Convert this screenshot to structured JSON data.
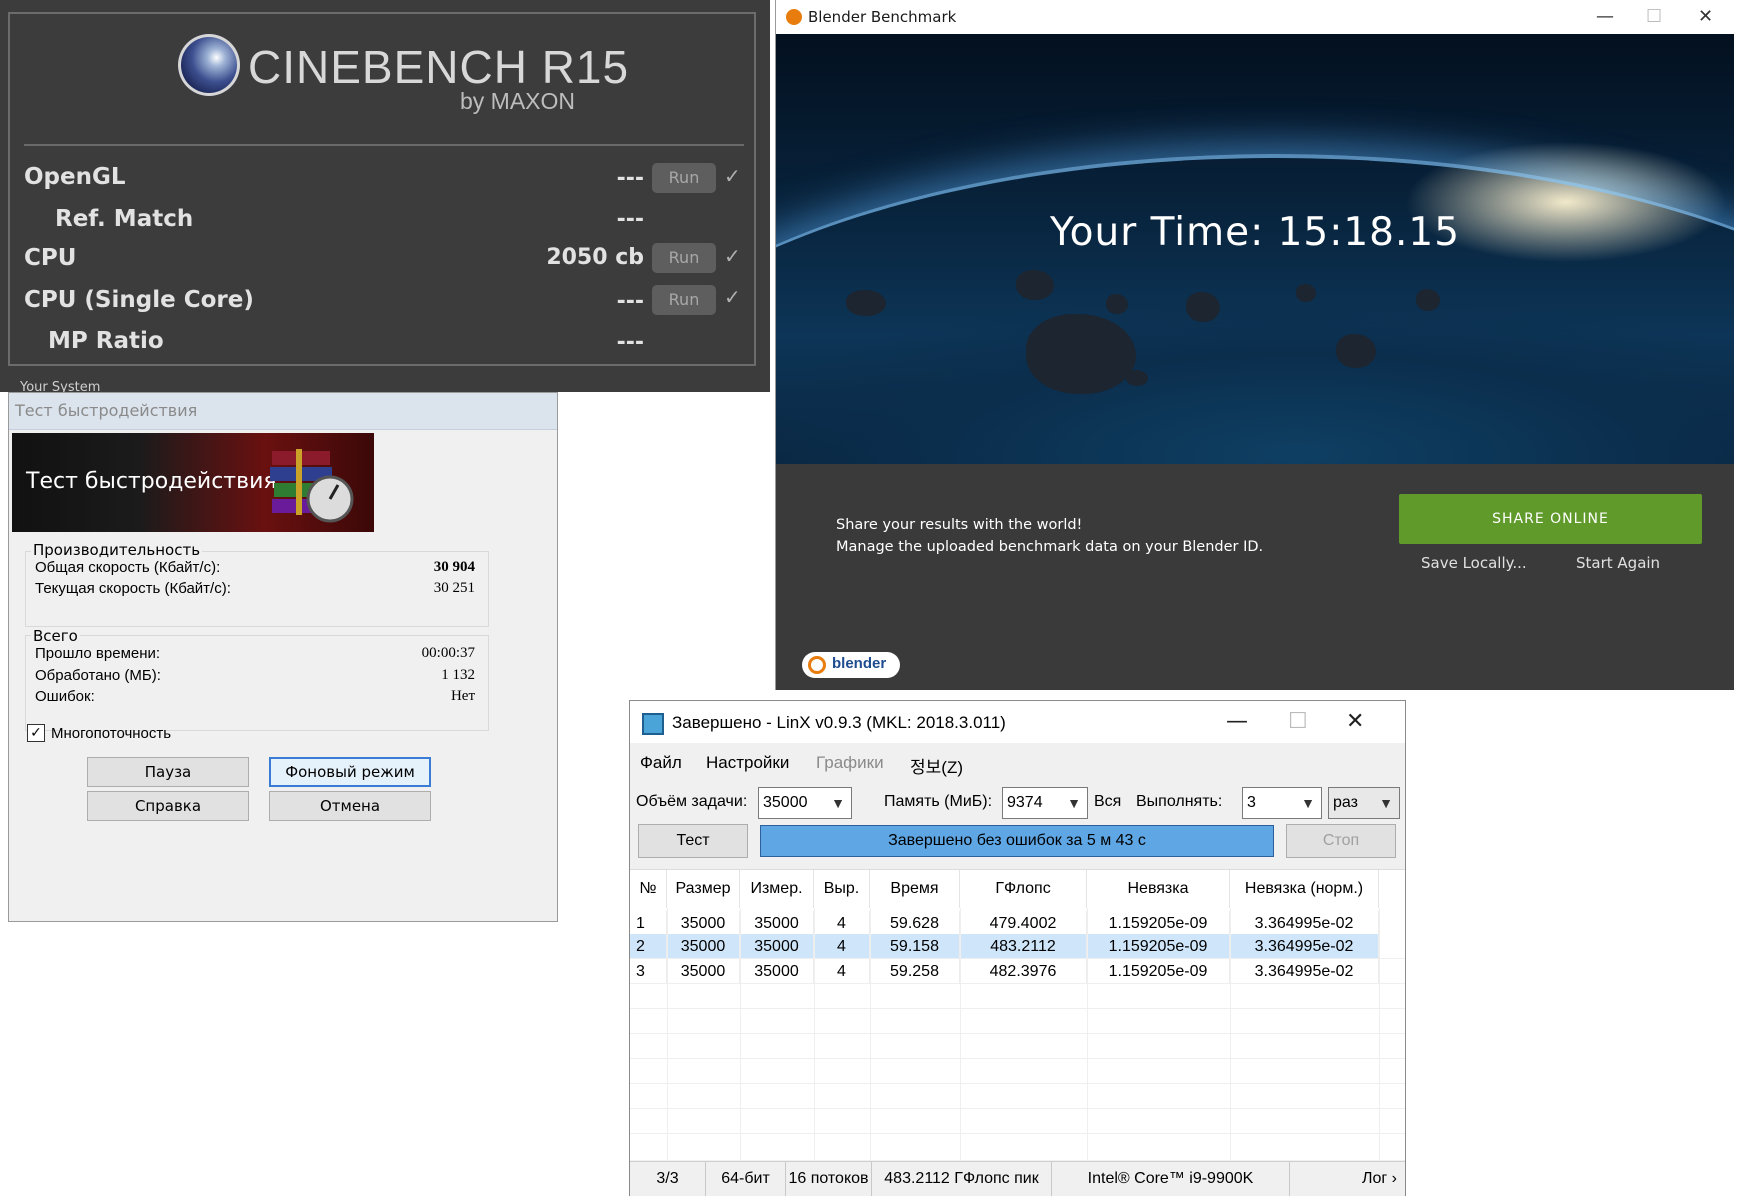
{
  "cinebench": {
    "logo_text": "CINEBENCH R15",
    "logo_by": "by MAXON",
    "peek_text": "Your System",
    "rows": [
      {
        "label": "OpenGL",
        "value": "---",
        "run": "Run",
        "check": "✓"
      },
      {
        "label": "Ref. Match",
        "value": "---"
      },
      {
        "label": "CPU",
        "value": "2050 cb",
        "run": "Run",
        "check": "✓"
      },
      {
        "label": "CPU (Single Core)",
        "value": "---",
        "run": "Run",
        "check": "✓"
      },
      {
        "label": "MP Ratio",
        "value": "---"
      }
    ]
  },
  "winrar": {
    "window_title": "Тест быстродействия",
    "banner_title": "Тест быстродействия",
    "perf_group": "Производительность",
    "overall_label": "Общая скорость (Кбайт/с):",
    "overall_value": "30 904",
    "current_label": "Текущая скорость (Кбайт/с):",
    "current_value": "30 251",
    "total_group": "Всего",
    "elapsed_label": "Прошло времени:",
    "elapsed_value": "00:00:37",
    "processed_label": "Обработано (МБ):",
    "processed_value": "1 132",
    "errors_label": "Ошибок:",
    "errors_value": "Нет",
    "multithread_label": "Многопоточность",
    "multithread_checked": true,
    "btn_pause": "Пауза",
    "btn_background": "Фоновый режим",
    "btn_help": "Справка",
    "btn_cancel": "Отмена"
  },
  "blender": {
    "window_title": "Blender Benchmark",
    "your_time": "Your Time: 15:18.15",
    "share_line1": "Share your results with the world!",
    "share_line2": "Manage the uploaded benchmark data on your Blender ID.",
    "share_button": "SHARE ONLINE",
    "save_locally": "Save Locally...",
    "start_again": "Start Again",
    "logo_text": "blender",
    "accent": "#5f9a2b",
    "minimize": "—",
    "maximize": "☐",
    "close": "✕"
  },
  "linx": {
    "window_title": "Завершено - LinX v0.9.3 (MKL: 2018.3.011)",
    "minimize": "—",
    "maximize": "☐",
    "close": "✕",
    "menu": [
      "Файл",
      "Настройки",
      "Графики",
      "정보(Z)"
    ],
    "problem_size_label": "Объём задачи:",
    "problem_size": "35000",
    "memory_label": "Память (МиБ):",
    "memory": "9374",
    "all_label": "Вся",
    "run_label": "Выполнять:",
    "run_count": "3",
    "run_unit": "раз",
    "test_button": "Тест",
    "status": "Завершено без ошибок за 5 м 43 с",
    "stop_button": "Стоп",
    "columns": [
      "№",
      "Размер",
      "Измер.",
      "Выр.",
      "Время",
      "ГФлопс",
      "Невязка",
      "Невязка (норм.)"
    ],
    "rows": [
      [
        "1",
        "35000",
        "35000",
        "4",
        "59.628",
        "479.4002",
        "1.159205e-09",
        "3.364995e-02"
      ],
      [
        "2",
        "35000",
        "35000",
        "4",
        "59.158",
        "483.2112",
        "1.159205e-09",
        "3.364995e-02"
      ],
      [
        "3",
        "35000",
        "35000",
        "4",
        "59.258",
        "482.3976",
        "1.159205e-09",
        "3.364995e-02"
      ]
    ],
    "statusbar": [
      "3/3",
      "64-бит",
      "16 потоков",
      "483.2112 ГФлопс пик",
      "Intel® Core™ i9-9900K",
      "Лог ›"
    ]
  }
}
